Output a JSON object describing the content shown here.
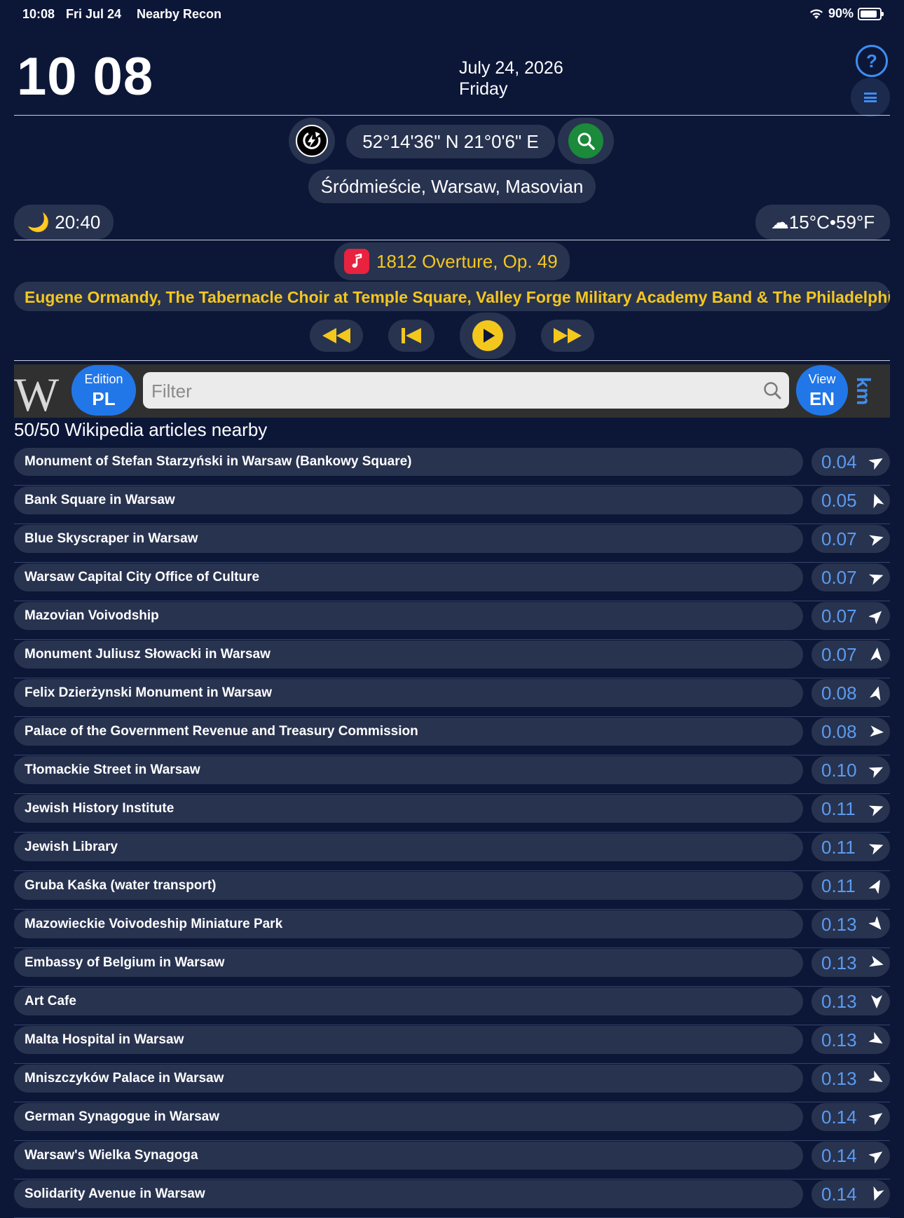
{
  "status_bar": {
    "time": "10:08",
    "date": "Fri Jul 24",
    "app": "Nearby Recon",
    "battery": "90%"
  },
  "header": {
    "clock": "10 08",
    "date_line": "July 24, 2026",
    "weekday": "Friday",
    "help_label": "?"
  },
  "location": {
    "coords": "52°14'36\" N 21°0'6\" E",
    "place": "Śródmieście, Warsaw, Masovian"
  },
  "sun": {
    "moon_glyph": "🌙",
    "time": "20:40"
  },
  "weather": {
    "cloud_glyph": "☁",
    "temp": "15°C•59°F"
  },
  "music": {
    "title": "1812 Overture, Op. 49",
    "artists": "Eugene Ormandy, The Tabernacle Choir at Temple Square, Valley Forge Military Academy Band & The Philadelphia Orchestra"
  },
  "wiki": {
    "logo": "W",
    "edition_label": "Edition",
    "edition_value": "PL",
    "filter_placeholder": "Filter",
    "view_label": "View",
    "view_value": "EN",
    "units": "km",
    "count_title": "50/50 Wikipedia articles nearby"
  },
  "colors": {
    "background": "#0c1738",
    "pill": "#283350",
    "accent": "#2277e8",
    "music_text": "#f4c71d",
    "distance_text": "#5b9bf0",
    "search_green": "#1b8a3a"
  },
  "articles": [
    {
      "name": "Monument of Stefan Starzyński in Warsaw (Bankowy Square)",
      "distance": "0.04",
      "bearing": 60
    },
    {
      "name": "Bank Square in Warsaw",
      "distance": "0.05",
      "bearing": 340
    },
    {
      "name": "Blue Skyscraper in Warsaw",
      "distance": "0.07",
      "bearing": 75
    },
    {
      "name": "Warsaw Capital City Office of Culture",
      "distance": "0.07",
      "bearing": 70
    },
    {
      "name": "Mazovian Voivodship",
      "distance": "0.07",
      "bearing": 45
    },
    {
      "name": "Monument Juliusz Słowacki in Warsaw",
      "distance": "0.07",
      "bearing": 5
    },
    {
      "name": "Felix Dzierżynski Monument in Warsaw",
      "distance": "0.08",
      "bearing": 15
    },
    {
      "name": "Palace of the Government Revenue and Treasury Commission",
      "distance": "0.08",
      "bearing": 95
    },
    {
      "name": "Tłomackie Street in Warsaw",
      "distance": "0.10",
      "bearing": 65
    },
    {
      "name": "Jewish History Institute",
      "distance": "0.11",
      "bearing": 70
    },
    {
      "name": "Jewish Library",
      "distance": "0.11",
      "bearing": 70
    },
    {
      "name": "Gruba Kaśka (water transport)",
      "distance": "0.11",
      "bearing": 30
    },
    {
      "name": "Mazowieckie Voivodeship Miniature Park",
      "distance": "0.13",
      "bearing": 140
    },
    {
      "name": "Embassy of Belgium in Warsaw",
      "distance": "0.13",
      "bearing": 105
    },
    {
      "name": "Art Cafe",
      "distance": "0.13",
      "bearing": 180
    },
    {
      "name": "Malta Hospital in Warsaw",
      "distance": "0.13",
      "bearing": 120
    },
    {
      "name": "Mniszczyków Palace in Warsaw",
      "distance": "0.13",
      "bearing": 120
    },
    {
      "name": "German Synagogue in Warsaw",
      "distance": "0.14",
      "bearing": 55
    },
    {
      "name": "Warsaw's Wielka Synagoga",
      "distance": "0.14",
      "bearing": 55
    },
    {
      "name": "Solidarity Avenue in Warsaw",
      "distance": "0.14",
      "bearing": 200
    }
  ]
}
